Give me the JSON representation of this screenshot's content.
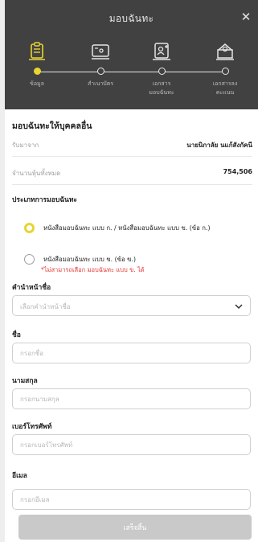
{
  "header": {
    "title": "มอบฉันทะ",
    "close_icon": "close-icon"
  },
  "steps": [
    {
      "label_line1": "ข้อมูล",
      "label_line2": "",
      "icon": "clipboard-icon",
      "active": true
    },
    {
      "label_line1": "สำเนาบัตร",
      "label_line2": "",
      "icon": "id-card-icon",
      "active": false
    },
    {
      "label_line1": "เอกสาร",
      "label_line2": "มอบฉันทะ",
      "icon": "document-user-icon",
      "active": false
    },
    {
      "label_line1": "เอกสารลง",
      "label_line2": "คะแนน",
      "icon": "ballot-box-icon",
      "active": false
    }
  ],
  "colors": {
    "accent": "#e7d532",
    "header_bg": "#414141",
    "error": "#e53935",
    "button_disabled": "#c9c9c9"
  },
  "form": {
    "section_title": "มอบฉันทะให้บุคคลอื่น",
    "received_from_label": "รับมาจาก",
    "received_from_value": "นายนิกาลัย นแก้สังกัคนี",
    "total_shares_label": "จำนวนหุ้นทั้งหมด",
    "total_shares_value": "754,506",
    "proxy_type_title": "ประเภทการมอบฉันทะ",
    "option_a_label": "หนังสือมอบฉันทะ แบบ ก. / หนังสือมอบฉันทะ แบบ ข. (ข้อ ก.)",
    "option_b_label": "หนังสือมอบฉันทะ แบบ ข. (ข้อ ข.)",
    "option_b_note": "*ไม่สามารถเลือก มอบฉันทะ แบบ ข. ได้",
    "title_label": "คำนำหน้าชื่อ",
    "title_placeholder": "เลือกคำนำหน้าชื่อ",
    "first_name_label": "ชื่อ",
    "first_name_placeholder": "กรอกชื่อ",
    "last_name_label": "นามสกุล",
    "last_name_placeholder": "กรอกนามสกุล",
    "phone_label": "เบอร์โทรศัพท์",
    "phone_placeholder": "กรอกเบอร์โทรศัพท์",
    "email_label": "อีเมล",
    "email_placeholder": "กรอกอีเมล"
  },
  "footer": {
    "submit_label": "เสร็จสิ้น"
  }
}
